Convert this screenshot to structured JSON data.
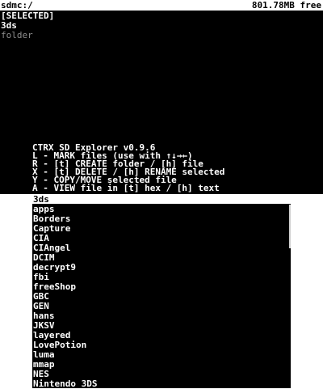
{
  "status_bar": {
    "path": "sdmc:/",
    "free_space": "801.78MB free"
  },
  "selection": {
    "header": "[SELECTED]",
    "items": [
      {
        "label": "3ds",
        "dim": false
      },
      {
        "label": "folder",
        "dim": true
      }
    ]
  },
  "help": {
    "title": "CTRX SD Explorer v0.9.6",
    "lines": [
      "L - MARK files (use with ↑↓→←)",
      "R - [t] CREATE folder / [h] file",
      "X - [t] DELETE / [h] RENAME selected",
      "Y - COPY/MOVE selected file",
      "A - VIEW file in [t] hex / [h] text"
    ]
  },
  "bottom": {
    "current_dir": "3ds",
    "files": [
      "apps",
      "Borders",
      "Capture",
      "CIA",
      "CIAngel",
      "DCIM",
      "decrypt9",
      "fbi",
      "freeShop",
      "GBC",
      "GEN",
      "hans",
      "JKSV",
      "layered",
      "LovePotion",
      "luma",
      "mmap",
      "NES",
      "Nintendo 3DS"
    ]
  }
}
